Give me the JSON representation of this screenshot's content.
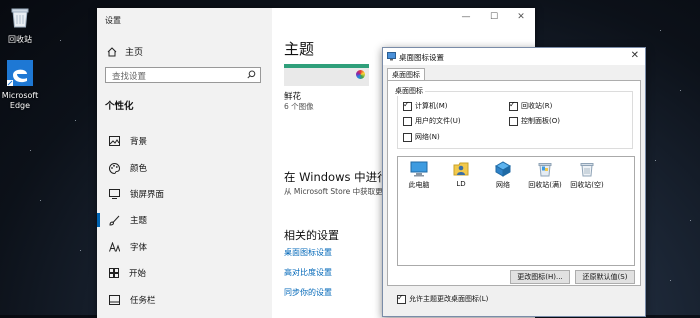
{
  "desktop": {
    "recycle_bin": "回收站",
    "edge_line1": "Microsoft",
    "edge_line2": "Edge"
  },
  "settings": {
    "window_title": "设置",
    "home": "主页",
    "search_placeholder": "查找设置",
    "section": "个性化",
    "nav": [
      {
        "label": "背景",
        "icon": "picture-icon"
      },
      {
        "label": "颜色",
        "icon": "palette-icon"
      },
      {
        "label": "锁屏界面",
        "icon": "monitor-icon"
      },
      {
        "label": "主题",
        "icon": "brush-icon"
      },
      {
        "label": "字体",
        "icon": "font-icon"
      },
      {
        "label": "开始",
        "icon": "start-icon"
      },
      {
        "label": "任务栏",
        "icon": "taskbar-icon"
      }
    ],
    "content": {
      "title": "主题",
      "theme_name": "鲜花",
      "theme_count": "6 个图像",
      "store_heading": "在 Windows 中进行更",
      "store_link": "从 Microsoft Store 中获取更",
      "related_heading": "相关的设置",
      "links": [
        "桌面图标设置",
        "高对比度设置",
        "同步你的设置"
      ]
    }
  },
  "dialog": {
    "title": "桌面图标设置",
    "tab": "桌面图标",
    "group_label": "桌面图标",
    "checkboxes": [
      {
        "label": "计算机(M)",
        "checked": true
      },
      {
        "label": "回收站(R)",
        "checked": true
      },
      {
        "label": "用户的文件(U)",
        "checked": false
      },
      {
        "label": "控制面板(O)",
        "checked": false
      },
      {
        "label": "网络(N)",
        "checked": false
      }
    ],
    "icons": [
      "此电脑",
      "LD",
      "网络",
      "回收站(满)",
      "回收站(空)"
    ],
    "change_icon_btn": "更改图标(H)...",
    "restore_btn": "还原默认值(S)",
    "allow_themes": "允许主题更改桌面图标(L)"
  },
  "colors": {
    "accent": "#0063b1",
    "link": "#0067b8"
  }
}
